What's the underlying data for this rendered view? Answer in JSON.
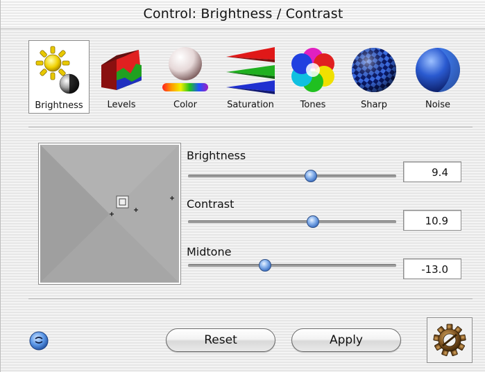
{
  "window": {
    "title": "Control: Brightness / Contrast"
  },
  "toolbar": {
    "items": [
      {
        "label": "Brightness",
        "icon": "brightness-icon",
        "selected": true
      },
      {
        "label": "Levels",
        "icon": "levels-icon",
        "selected": false
      },
      {
        "label": "Color",
        "icon": "color-icon",
        "selected": false
      },
      {
        "label": "Saturation",
        "icon": "saturation-icon",
        "selected": false
      },
      {
        "label": "Tones",
        "icon": "tones-icon",
        "selected": false
      },
      {
        "label": "Sharp",
        "icon": "sharp-icon",
        "selected": false
      },
      {
        "label": "Noise",
        "icon": "noise-icon",
        "selected": false
      }
    ]
  },
  "sliders": [
    {
      "label": "Brightness",
      "value": "9.4",
      "position": 0.59
    },
    {
      "label": "Contrast",
      "value": "10.9",
      "position": 0.6
    },
    {
      "label": "Midtone",
      "value": "-13.0",
      "position": 0.37
    }
  ],
  "buttons": {
    "reset": "Reset",
    "apply": "Apply"
  },
  "colors": {
    "slider_thumb": "#5a8ad6",
    "preview_gray": "#a9a9a9",
    "help_icon": "#3b78d0",
    "gear_icon": "#6b4a1e"
  }
}
